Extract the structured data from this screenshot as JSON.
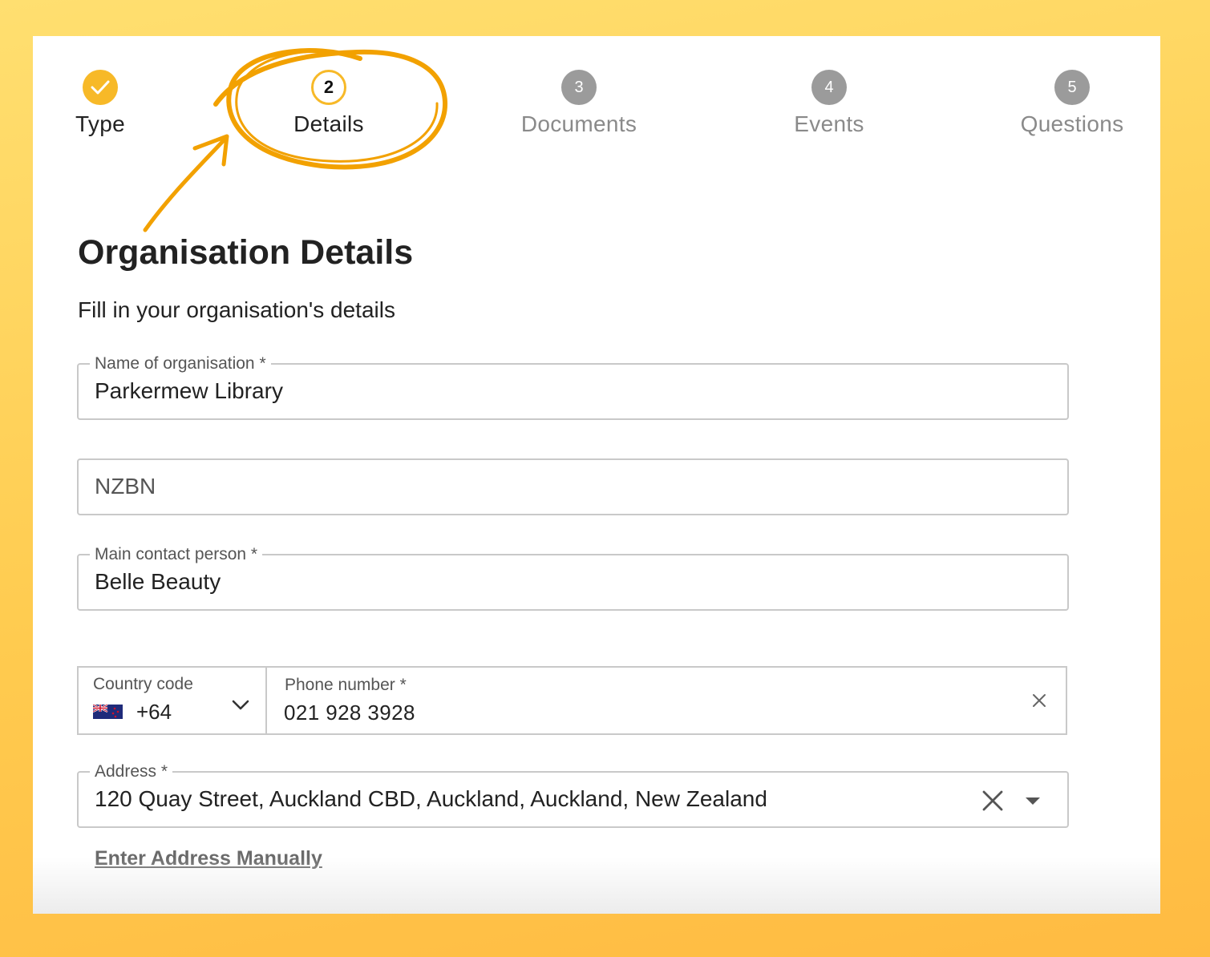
{
  "stepper": {
    "steps": [
      {
        "number": "",
        "label": "Type",
        "state": "completed"
      },
      {
        "number": "2",
        "label": "Details",
        "state": "active"
      },
      {
        "number": "3",
        "label": "Documents",
        "state": "upcoming"
      },
      {
        "number": "4",
        "label": "Events",
        "state": "upcoming"
      },
      {
        "number": "5",
        "label": "Questions",
        "state": "upcoming"
      }
    ]
  },
  "form": {
    "title": "Organisation Details",
    "subtitle": "Fill in your organisation's details",
    "organisation_name": {
      "label": "Name of organisation *",
      "value": "Parkermew Library"
    },
    "nzbn": {
      "placeholder": "NZBN",
      "value": ""
    },
    "contact_person": {
      "label": "Main contact person *",
      "value": "Belle Beauty"
    },
    "country_code": {
      "label": "Country code",
      "value": "+64",
      "flag": "new-zealand-flag"
    },
    "phone_number": {
      "label": "Phone number *",
      "value": "021 928 3928"
    },
    "address": {
      "label": "Address *",
      "value": "120 Quay Street, Auckland CBD, Auckland, Auckland, New Zealand"
    },
    "manual_address_link": "Enter Address Manually"
  },
  "colors": {
    "accent": "#f7b928",
    "annotation": "#f2a100",
    "background_gradient": [
      "#ffdf70",
      "#ffbb42"
    ],
    "inactive_step": "#9b9b9b"
  }
}
